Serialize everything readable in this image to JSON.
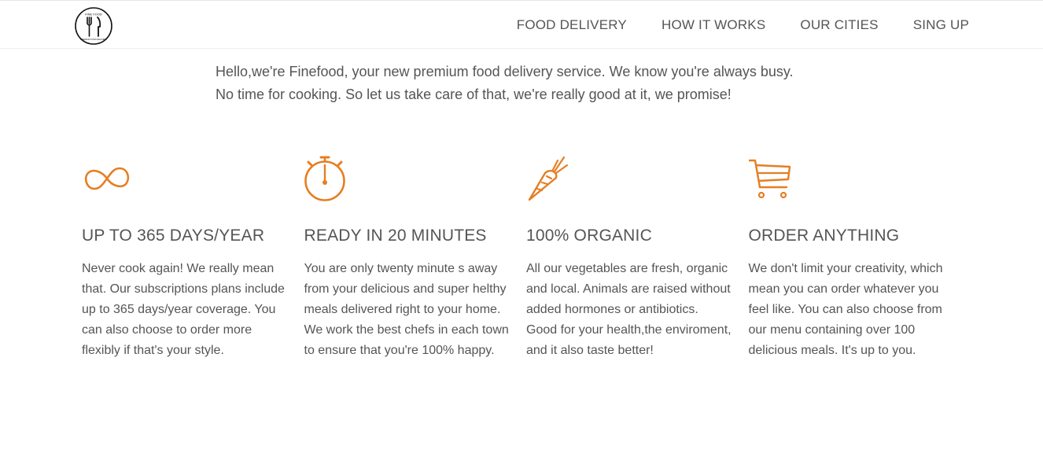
{
  "header": {
    "logo": {
      "icon": "fork-knife-logo-icon",
      "top_text": "FINE FOOD",
      "bottom_text": "PREMIUM FOOD DELIVERY"
    },
    "nav": [
      {
        "label": "FOOD DELIVERY"
      },
      {
        "label": "HOW IT WORKS"
      },
      {
        "label": "OUR CITIES"
      },
      {
        "label": "SING UP"
      }
    ]
  },
  "intro": {
    "line1": "Hello,we're Finefood, your new premium food delivery service. We know you're always busy.",
    "line2": "No time for cooking. So let us take care of that, we're really good at it, we promise!"
  },
  "features": [
    {
      "icon": "infinity-icon",
      "title": "UP TO 365 DAYS/YEAR",
      "text": "Never cook again! We really mean that. Our subscriptions plans include up to 365 days/year coverage. You can also choose to order more flexibly if that's your style."
    },
    {
      "icon": "stopwatch-icon",
      "title": "READY IN 20 MINUTES",
      "text": "You are only twenty minute s away from your delicious and super helthy meals delivered right to your home. We work the best chefs in each town to ensure that you're 100% happy."
    },
    {
      "icon": "carrot-icon",
      "title": "100% ORGANIC",
      "text": "All our vegetables are fresh, organic and local. Animals are raised without added hormones or antibiotics. Good for your health,the enviroment, and it also taste better!"
    },
    {
      "icon": "shopping-cart-icon",
      "title": "ORDER ANYTHING",
      "text": "We don't limit your creativity, which mean you can order whatever you feel like. You can also choose from our menu containing over 100 delicious meals. It's up to you."
    }
  ],
  "colors": {
    "accent": "#e67e22",
    "text": "#555555",
    "background": "#ffffff"
  }
}
